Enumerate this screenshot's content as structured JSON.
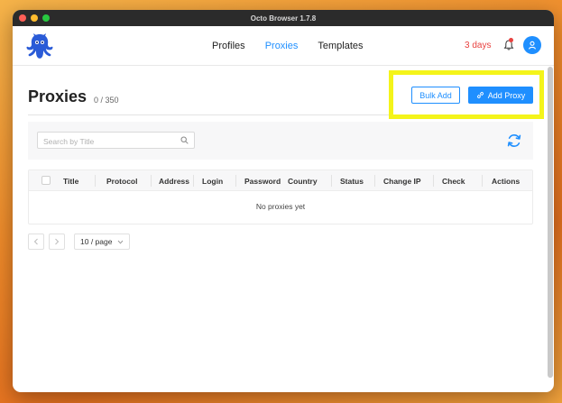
{
  "window": {
    "title": "Octo Browser 1.7.8"
  },
  "nav": {
    "items": [
      {
        "label": "Profiles",
        "active": false
      },
      {
        "label": "Proxies",
        "active": true
      },
      {
        "label": "Templates",
        "active": false
      }
    ]
  },
  "header": {
    "trial_label": "3 days",
    "notification_badge": true
  },
  "page": {
    "title": "Proxies",
    "count": "0 / 350"
  },
  "actions": {
    "bulk_add_label": "Bulk Add",
    "add_proxy_label": "Add Proxy"
  },
  "search": {
    "placeholder": "Search by Title",
    "value": ""
  },
  "table": {
    "columns": [
      "Title",
      "Protocol",
      "Address",
      "Login",
      "Password",
      "Country",
      "Status",
      "Change IP",
      "Check",
      "Actions"
    ],
    "empty_text": "No proxies yet"
  },
  "pagination": {
    "page_size_label": "10 / page"
  },
  "icons": [
    "octopus-logo",
    "bell-icon",
    "user-icon",
    "link-icon",
    "search-icon",
    "refresh-icon",
    "chevron-left-icon",
    "chevron-right-icon",
    "chevron-down-icon"
  ],
  "colors": {
    "accent": "#1f8fff",
    "alert": "#e8413f",
    "highlight": "#f4f41a"
  }
}
